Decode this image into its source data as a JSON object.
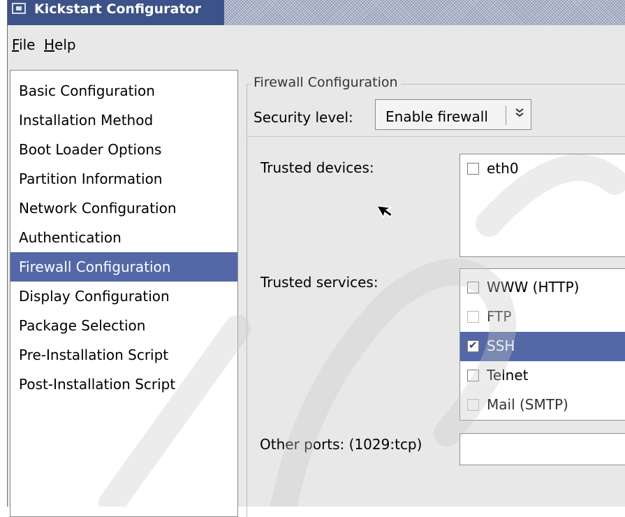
{
  "window": {
    "title": "Kickstart Configurator"
  },
  "menubar": {
    "file": {
      "mnemonic": "F",
      "rest": "ile"
    },
    "help": {
      "mnemonic": "H",
      "rest": "elp"
    }
  },
  "sidebar": {
    "items": [
      {
        "label": "Basic Configuration"
      },
      {
        "label": "Installation Method"
      },
      {
        "label": "Boot Loader Options"
      },
      {
        "label": "Partition Information"
      },
      {
        "label": "Network Configuration"
      },
      {
        "label": "Authentication"
      },
      {
        "label": "Firewall Configuration",
        "selected": true
      },
      {
        "label": "Display Configuration"
      },
      {
        "label": "Package Selection"
      },
      {
        "label": "Pre-Installation Script"
      },
      {
        "label": "Post-Installation Script"
      }
    ]
  },
  "firewall": {
    "section_title": "Firewall Configuration",
    "security_label": "Security level:",
    "security_value": "Enable firewall",
    "trusted_devices_label": "Trusted devices:",
    "devices": [
      {
        "label": "eth0",
        "checked": false
      }
    ],
    "trusted_services_label": "Trusted services:",
    "services": [
      {
        "label": "WWW (HTTP)",
        "checked": false
      },
      {
        "label": "FTP",
        "checked": false
      },
      {
        "label": "SSH",
        "checked": true,
        "selected": true
      },
      {
        "label": "Telnet",
        "checked": false
      },
      {
        "label": "Mail (SMTP)",
        "checked": false
      }
    ],
    "other_ports_label": "Other ports: (1029:tcp)",
    "other_ports_value": ""
  },
  "colors": {
    "selection": "#5468a8",
    "titlebar": "#3c5288",
    "window_bg": "#e8e8e8"
  },
  "icons": {
    "window_menu": "window-menu-icon",
    "dropdown": "chevron-down-icon",
    "cursor": "mouse-pointer-icon"
  }
}
